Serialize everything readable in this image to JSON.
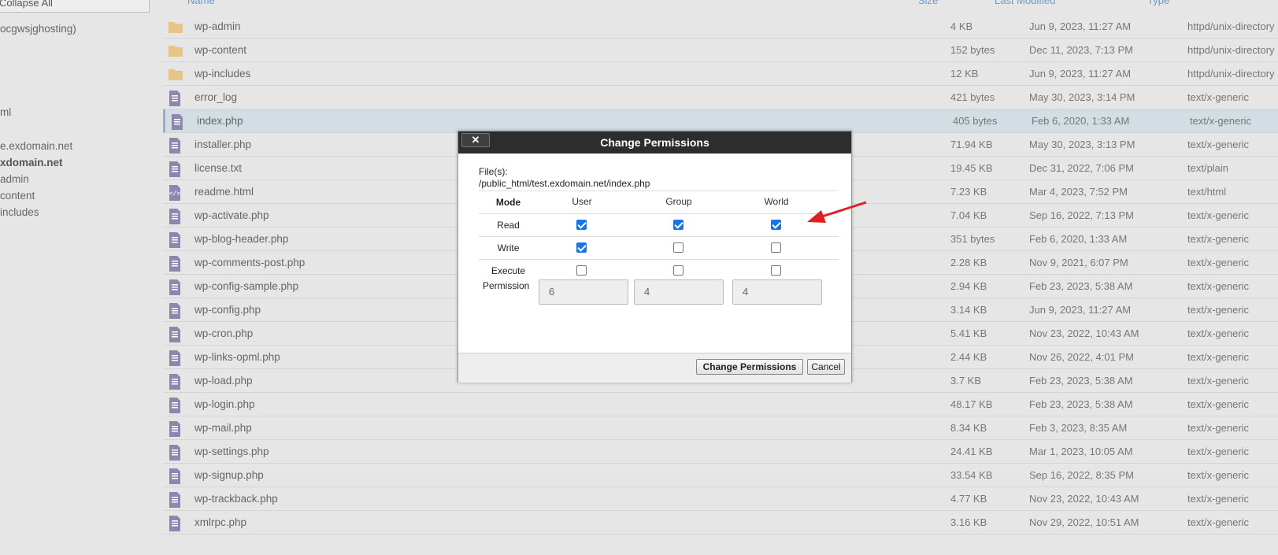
{
  "tree": {
    "collapse_label": "Collapse All",
    "items": [
      {
        "label": "ocgwsjghosting)",
        "bold": false
      },
      {
        "label": "ml",
        "bold": false
      },
      {
        "label": "e.exdomain.net",
        "bold": false
      },
      {
        "label": "xdomain.net",
        "bold": true
      },
      {
        "label": "admin",
        "bold": false
      },
      {
        "label": "content",
        "bold": false
      },
      {
        "label": "includes",
        "bold": false
      }
    ]
  },
  "table": {
    "headers": {
      "name": "Name",
      "size": "Size",
      "modified": "Last Modified",
      "type": "Type"
    },
    "rows": [
      {
        "name": "wp-admin",
        "size": "4 KB",
        "modified": "Jun 9, 2023, 11:27 AM",
        "type": "httpd/unix-directory",
        "icon": "folder-icon"
      },
      {
        "name": "wp-content",
        "size": "152 bytes",
        "modified": "Dec 11, 2023, 7:13 PM",
        "type": "httpd/unix-directory",
        "icon": "folder-icon"
      },
      {
        "name": "wp-includes",
        "size": "12 KB",
        "modified": "Jun 9, 2023, 11:27 AM",
        "type": "httpd/unix-directory",
        "icon": "folder-icon"
      },
      {
        "name": "error_log",
        "size": "421 bytes",
        "modified": "May 30, 2023, 3:14 PM",
        "type": "text/x-generic",
        "icon": "file-icon"
      },
      {
        "name": "index.php",
        "size": "405 bytes",
        "modified": "Feb 6, 2020, 1:33 AM",
        "type": "text/x-generic",
        "icon": "file-icon",
        "selected": true
      },
      {
        "name": "installer.php",
        "size": "71.94 KB",
        "modified": "May 30, 2023, 3:13 PM",
        "type": "text/x-generic",
        "icon": "file-icon"
      },
      {
        "name": "license.txt",
        "size": "19.45 KB",
        "modified": "Dec 31, 2022, 7:06 PM",
        "type": "text/plain",
        "icon": "file-icon"
      },
      {
        "name": "readme.html",
        "size": "7.23 KB",
        "modified": "Mar 4, 2023, 7:52 PM",
        "type": "text/html",
        "icon": "html-file-icon"
      },
      {
        "name": "wp-activate.php",
        "size": "7.04 KB",
        "modified": "Sep 16, 2022, 7:13 PM",
        "type": "text/x-generic",
        "icon": "file-icon"
      },
      {
        "name": "wp-blog-header.php",
        "size": "351 bytes",
        "modified": "Feb 6, 2020, 1:33 AM",
        "type": "text/x-generic",
        "icon": "file-icon"
      },
      {
        "name": "wp-comments-post.php",
        "size": "2.28 KB",
        "modified": "Nov 9, 2021, 6:07 PM",
        "type": "text/x-generic",
        "icon": "file-icon"
      },
      {
        "name": "wp-config-sample.php",
        "size": "2.94 KB",
        "modified": "Feb 23, 2023, 5:38 AM",
        "type": "text/x-generic",
        "icon": "file-icon"
      },
      {
        "name": "wp-config.php",
        "size": "3.14 KB",
        "modified": "Jun 9, 2023, 11:27 AM",
        "type": "text/x-generic",
        "icon": "file-icon"
      },
      {
        "name": "wp-cron.php",
        "size": "5.41 KB",
        "modified": "Nov 23, 2022, 10:43 AM",
        "type": "text/x-generic",
        "icon": "file-icon"
      },
      {
        "name": "wp-links-opml.php",
        "size": "2.44 KB",
        "modified": "Nov 26, 2022, 4:01 PM",
        "type": "text/x-generic",
        "icon": "file-icon"
      },
      {
        "name": "wp-load.php",
        "size": "3.7 KB",
        "modified": "Feb 23, 2023, 5:38 AM",
        "type": "text/x-generic",
        "icon": "file-icon"
      },
      {
        "name": "wp-login.php",
        "size": "48.17 KB",
        "modified": "Feb 23, 2023, 5:38 AM",
        "type": "text/x-generic",
        "icon": "file-icon"
      },
      {
        "name": "wp-mail.php",
        "size": "8.34 KB",
        "modified": "Feb 3, 2023, 8:35 AM",
        "type": "text/x-generic",
        "icon": "file-icon"
      },
      {
        "name": "wp-settings.php",
        "size": "24.41 KB",
        "modified": "Mar 1, 2023, 10:05 AM",
        "type": "text/x-generic",
        "icon": "file-icon"
      },
      {
        "name": "wp-signup.php",
        "size": "33.54 KB",
        "modified": "Sep 16, 2022, 8:35 PM",
        "type": "text/x-generic",
        "icon": "file-icon"
      },
      {
        "name": "wp-trackback.php",
        "size": "4.77 KB",
        "modified": "Nov 23, 2022, 10:43 AM",
        "type": "text/x-generic",
        "icon": "file-icon"
      },
      {
        "name": "xmlrpc.php",
        "size": "3.16 KB",
        "modified": "Nov 29, 2022, 10:51 AM",
        "type": "text/x-generic",
        "icon": "file-icon"
      }
    ]
  },
  "dialog": {
    "title": "Change Permissions",
    "close_glyph": "✕",
    "files_label": "File(s):",
    "files_path": "/public_html/test.exdomain.net/index.php",
    "mode_label": "Mode",
    "columns": [
      "User",
      "Group",
      "World"
    ],
    "rows": [
      {
        "label": "Read",
        "checked": [
          true,
          true,
          true
        ]
      },
      {
        "label": "Write",
        "checked": [
          true,
          false,
          false
        ]
      },
      {
        "label": "Execute",
        "checked": [
          false,
          false,
          false
        ]
      }
    ],
    "permission_label": "Permission",
    "permission_values": [
      "6",
      "4",
      "4"
    ],
    "change_button": "Change Permissions",
    "cancel_button": "Cancel"
  },
  "colors": {
    "dialog_title_bg": "#2d2d2d",
    "checkbox_checked": "#1a73e8",
    "arrow": "#e02020",
    "folder": "#e8c486",
    "file": "#8f86ad",
    "selected_row": "#d2dde4"
  }
}
